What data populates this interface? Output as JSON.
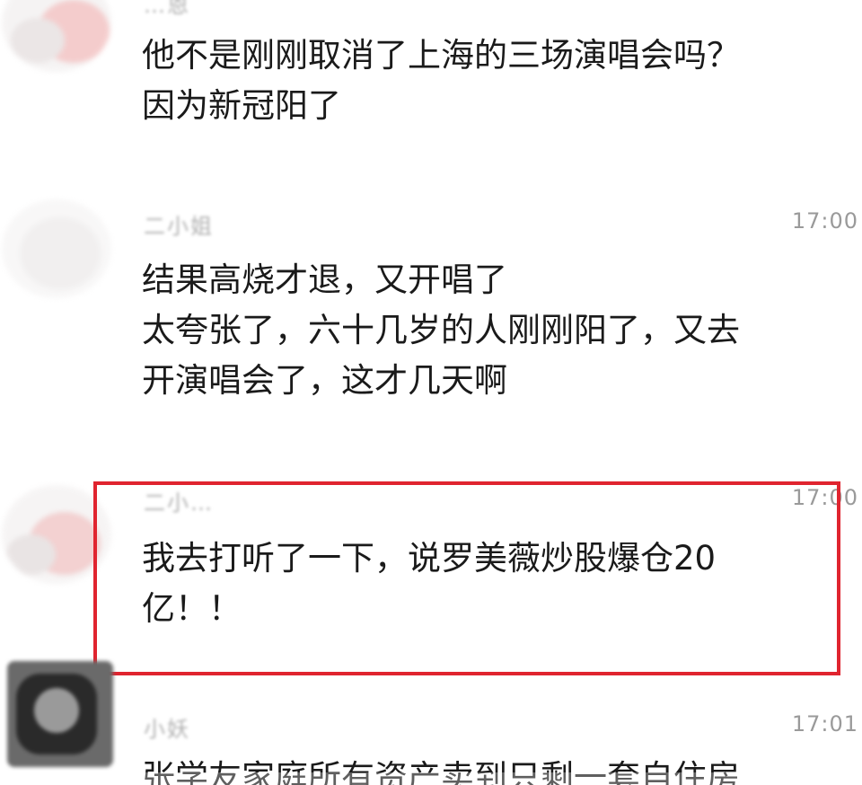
{
  "comments": [
    {
      "username": "…恩",
      "time": "",
      "lines": [
        "他不是刚刚取消了上海的三场演唱会吗？",
        "因为新冠阳了"
      ]
    },
    {
      "username": "二小姐",
      "time": "17:00",
      "lines": [
        "结果高烧才退，又开唱了",
        "太夸张了，六十几岁的人刚刚阳了，又去",
        "开演唱会了，这才几天啊"
      ]
    },
    {
      "username": "二小…",
      "time": "17:00",
      "lines": [
        "我去打听了一下，说罗美薇炒股爆仓20",
        "亿！！"
      ]
    },
    {
      "username": "小妖",
      "time": "17:01",
      "lines": [
        "张学友家庭所有资产卖到只剩一套自住房"
      ]
    }
  ],
  "colors": {
    "highlight_border": "#e0242f",
    "text": "#1a1a1a",
    "time": "#9a9a9a"
  }
}
